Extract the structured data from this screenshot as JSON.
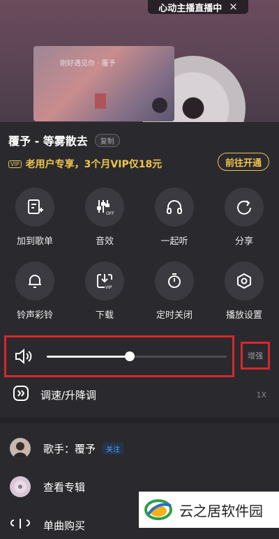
{
  "top_bar": {
    "live_label": "心动主播直播中"
  },
  "cover": {
    "text": "刚好遇见你 · 覆予"
  },
  "song": {
    "title": "覆予 - 等雾散去",
    "copy_label": "复制"
  },
  "vip": {
    "tag": "VIP",
    "text": "老用户专享，3个月VIP仅18元",
    "button": "前往开通"
  },
  "actions": [
    {
      "label": "加到歌单",
      "icon": "add-to-playlist-icon"
    },
    {
      "label": "音效",
      "icon": "equalizer-off-icon"
    },
    {
      "label": "一起听",
      "icon": "headphones-icon"
    },
    {
      "label": "分享",
      "icon": "share-icon"
    },
    {
      "label": "铃声彩铃",
      "icon": "bell-icon"
    },
    {
      "label": "下载",
      "icon": "download-vip-icon"
    },
    {
      "label": "定时关闭",
      "icon": "timer-icon"
    },
    {
      "label": "播放设置",
      "icon": "settings-icon"
    }
  ],
  "volume": {
    "level": 0.46,
    "enhance_label": "增强"
  },
  "speed": {
    "label": "调速/升降调",
    "value": "1X"
  },
  "list": [
    {
      "label": "歌手：覆予",
      "badge": "关注"
    },
    {
      "label": "查看专辑"
    },
    {
      "label": "单曲购买"
    }
  ],
  "watermark": {
    "text": "云之居软件园"
  },
  "colors": {
    "accent_gold": "#f0c64e",
    "highlight_red": "#d9262d",
    "sheet_bg": "#2a2a2e"
  }
}
